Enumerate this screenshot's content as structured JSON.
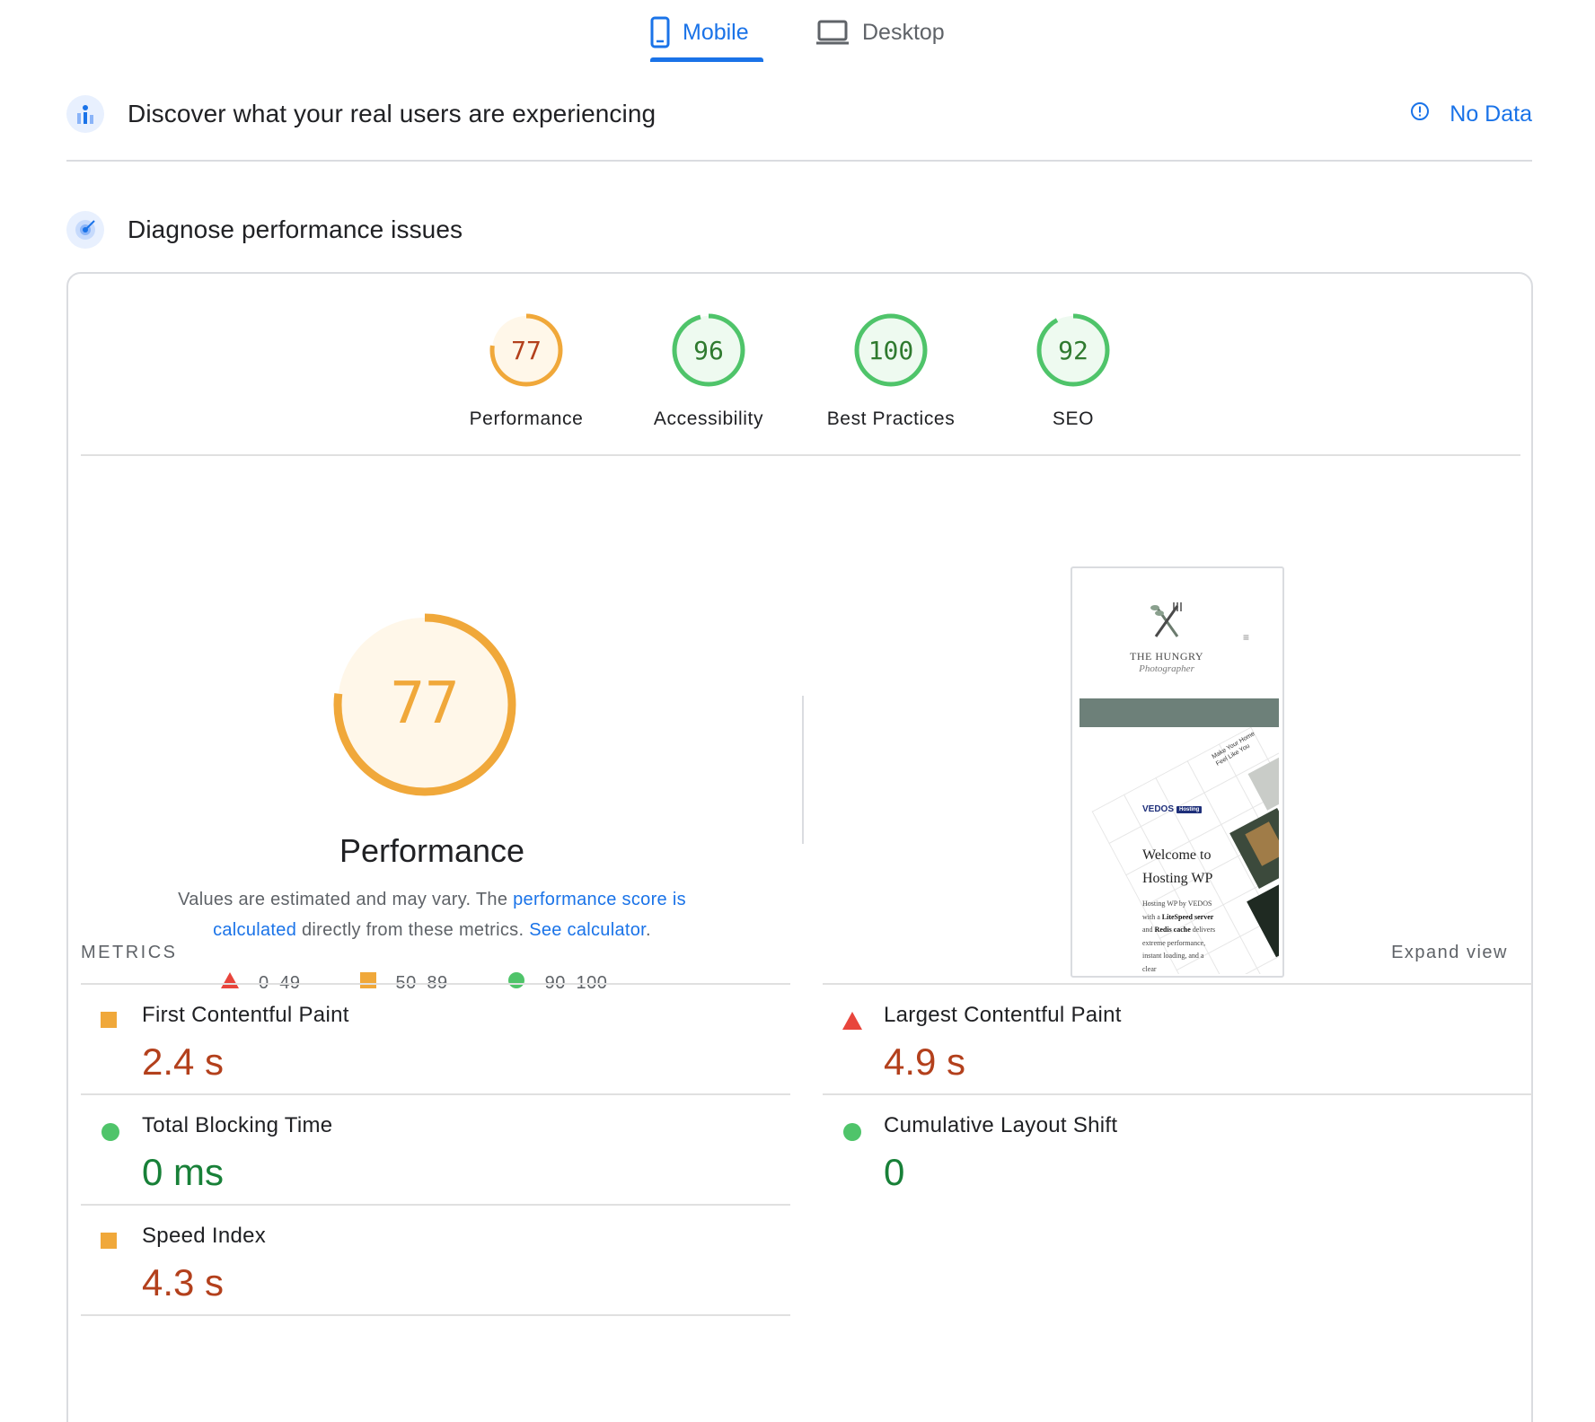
{
  "tabs": {
    "mobile": "Mobile",
    "desktop": "Desktop"
  },
  "real_users": {
    "title": "Discover what your real users are experiencing",
    "status": "No Data"
  },
  "diagnose": {
    "title": "Diagnose performance issues"
  },
  "scores": [
    {
      "label": "Performance",
      "value": "77",
      "color": "#f0a83a",
      "fill": "#fff7e9",
      "text_color": "#b3401c",
      "fraction": 0.77
    },
    {
      "label": "Accessibility",
      "value": "96",
      "color": "#4fc46a",
      "fill": "#eefaf0",
      "text_color": "#2f7a2f",
      "fraction": 0.96
    },
    {
      "label": "Best Practices",
      "value": "100",
      "color": "#4fc46a",
      "fill": "#eefaf0",
      "text_color": "#2f7a2f",
      "fraction": 1.0
    },
    {
      "label": "SEO",
      "value": "92",
      "color": "#4fc46a",
      "fill": "#eefaf0",
      "text_color": "#2f7a2f",
      "fraction": 0.92
    }
  ],
  "performance": {
    "score": "77",
    "fraction": 0.77,
    "title": "Performance",
    "desc_prefix": "Values are estimated and may vary. The ",
    "desc_link": "performance score is calculated",
    "desc_middle": " directly from these metrics. ",
    "desc_calc": "See calculator",
    "desc_suffix": "."
  },
  "legend": [
    {
      "shape": "triangle",
      "range": "0–49",
      "color": "#e8453c"
    },
    {
      "shape": "square",
      "range": "50–89",
      "color": "#f0a83a"
    },
    {
      "shape": "circle",
      "range": "90–100",
      "color": "#4fc46a"
    }
  ],
  "thumbnail": {
    "brand_line1": "THE HUNGRY",
    "brand_line2": "Photographer",
    "host_name": "VEDOS",
    "host_tag": "Hosting",
    "tagline": "Make Your Home Feel Like You",
    "hero_title_1": "Welcome to",
    "hero_title_2": "Hosting WP",
    "hero_text_1": "Hosting WP by VEDOS with a",
    "hero_text_bold_1": "LiteSpeed server",
    "hero_text_2": " and ",
    "hero_text_bold_2": "Redis cache",
    "hero_text_3": " delivers extreme performance, instant loading, and a clear"
  },
  "metrics": {
    "label": "METRICS",
    "expand": "Expand view",
    "items": [
      {
        "name": "First Contentful Paint",
        "value": "2.4 s",
        "status": "square",
        "color": "#f0a83a"
      },
      {
        "name": "Largest Contentful Paint",
        "value": "4.9 s",
        "status": "triangle",
        "color": "#e8453c"
      },
      {
        "name": "Total Blocking Time",
        "value": "0 ms",
        "status": "circle",
        "color": "#4fc46a"
      },
      {
        "name": "Cumulative Layout Shift",
        "value": "0",
        "status": "circle",
        "color": "#4fc46a"
      },
      {
        "name": "Speed Index",
        "value": "4.3 s",
        "status": "square",
        "color": "#f0a83a"
      }
    ]
  }
}
